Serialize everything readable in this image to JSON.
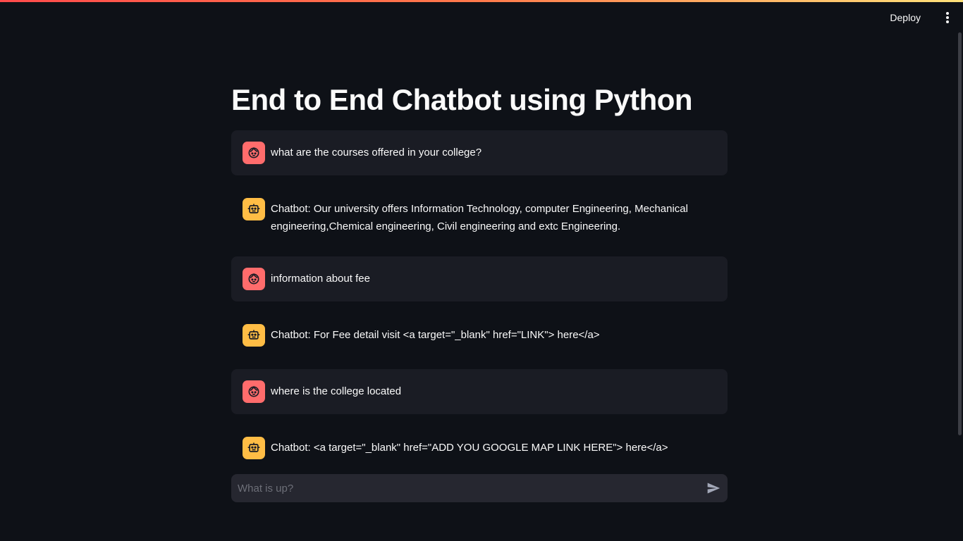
{
  "header": {
    "deploy_label": "Deploy",
    "menu_icon": "vertical-dots-icon"
  },
  "page": {
    "title": "End to End Chatbot using Python"
  },
  "messages": [
    {
      "role": "user",
      "avatar_icon": "user-face-icon",
      "text": "what are the courses offered in your college?"
    },
    {
      "role": "assistant",
      "avatar_icon": "robot-icon",
      "text": "Chatbot: Our university offers Information Technology, computer Engineering, Mechanical engineering,Chemical engineering, Civil engineering and extc Engineering."
    },
    {
      "role": "user",
      "avatar_icon": "user-face-icon",
      "text": "information about fee"
    },
    {
      "role": "assistant",
      "avatar_icon": "robot-icon",
      "text": "Chatbot: For Fee detail visit <a target=\"_blank\" href=\"LINK\"> here</a>"
    },
    {
      "role": "user",
      "avatar_icon": "user-face-icon",
      "text": "where is the college located"
    },
    {
      "role": "assistant",
      "avatar_icon": "robot-icon",
      "text": "Chatbot: <a target=\"_blank\" href=\"ADD YOU GOOGLE MAP LINK HERE\"> here</a>"
    }
  ],
  "chat_input": {
    "placeholder": "What is up?",
    "value": "",
    "send_icon": "send-icon"
  },
  "colors": {
    "background": "#0e1117",
    "user_message_bg": "#1a1c24",
    "user_avatar": "#ff6c6c",
    "bot_avatar": "#ffbd45",
    "input_bg": "#262730"
  }
}
